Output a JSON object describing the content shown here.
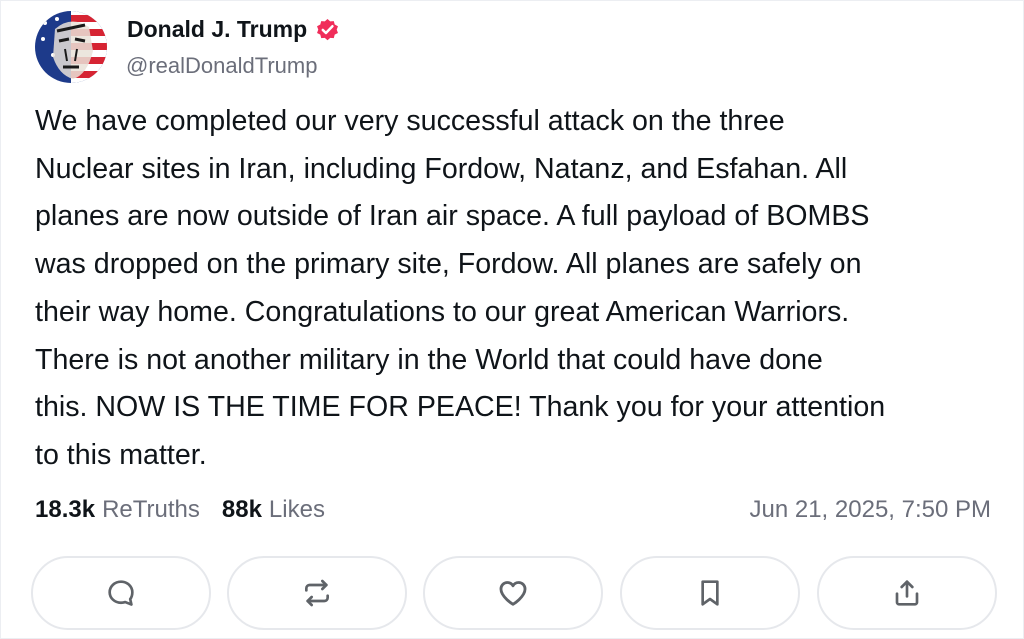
{
  "author": {
    "display_name": "Donald J. Trump",
    "handle": "@realDonaldTrump",
    "verified": true,
    "verified_color": "#f02d5a",
    "avatar_icon": "avatar-portrait"
  },
  "post": {
    "text": "We have completed our very successful attack on the three\nNuclear sites in Iran, including Fordow, Natanz, and Esfahan. All\nplanes are now outside of Iran air space. A full payload of BOMBS\nwas dropped on the primary site, Fordow. All planes are safely on\ntheir way home. Congratulations to our great American Warriors.\nThere is not another military in the World that could have done\nthis. NOW IS THE TIME FOR PEACE! Thank you for your attention\nto this matter."
  },
  "stats": {
    "retruths_count": "18.3k",
    "retruths_label": "ReTruths",
    "likes_count": "88k",
    "likes_label": "Likes",
    "timestamp": "Jun 21, 2025, 7:50 PM"
  },
  "actions": [
    {
      "name": "reply",
      "icon": "comment-icon"
    },
    {
      "name": "retruth",
      "icon": "repost-icon"
    },
    {
      "name": "like",
      "icon": "heart-icon"
    },
    {
      "name": "bookmark",
      "icon": "bookmark-icon"
    },
    {
      "name": "share",
      "icon": "share-icon"
    }
  ],
  "colors": {
    "text": "#0f1419",
    "muted": "#6b6e7a",
    "icon": "#5f6368",
    "border": "#e6e8ec"
  }
}
